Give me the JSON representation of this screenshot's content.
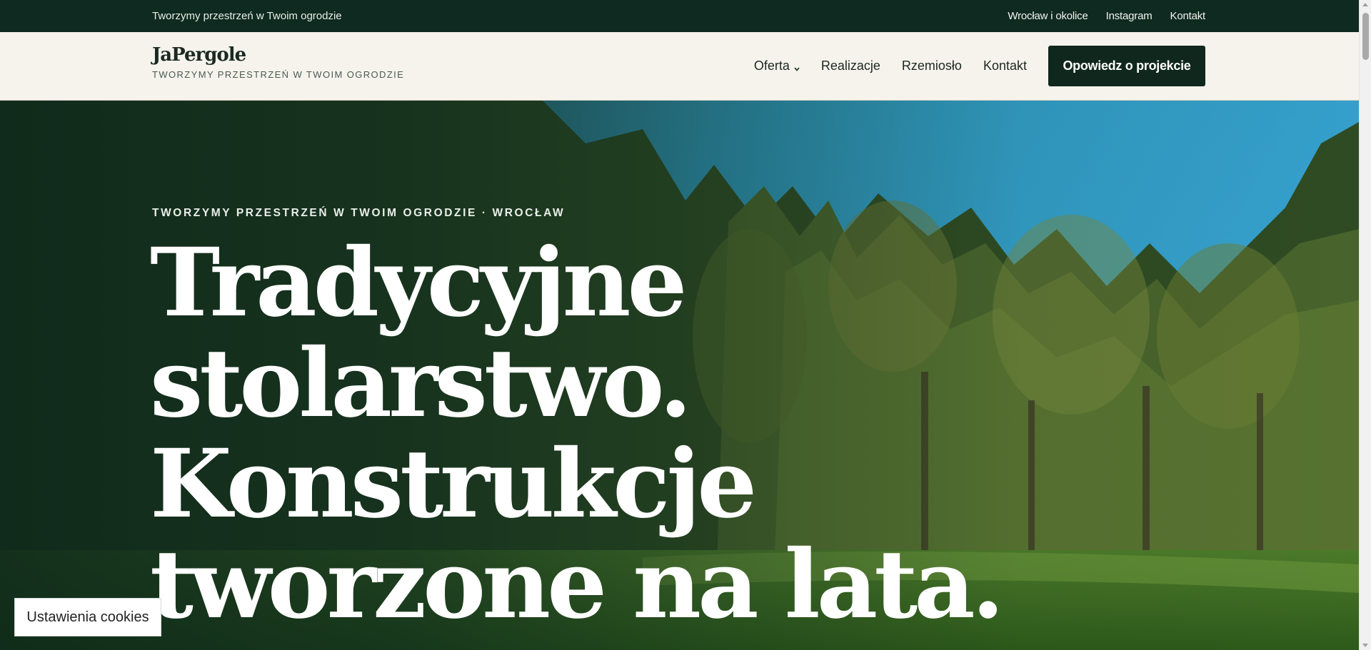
{
  "topbar": {
    "tagline": "Tworzymy przestrzeń w Twoim ogrodzie",
    "links": [
      "Wrocław i okolice",
      "Instagram",
      "Kontakt"
    ]
  },
  "header": {
    "logo_text": "JaPergole",
    "logo_tagline": "TWORZYMY PRZESTRZEŃ W TWOIM OGRODZIE",
    "nav": {
      "oferta": "Oferta",
      "realizacje": "Realizacje",
      "rzemioslo": "Rzemiosło",
      "kontakt": "Kontakt"
    },
    "cta_label": "Opowiedz o projekcie"
  },
  "hero": {
    "eyebrow": "TWORZYMY PRZESTRZEŃ W TWOIM OGRODZIE · WROCŁAW",
    "headline_lines": [
      "Tradycyjne",
      "stolarstwo.",
      "Konstrukcje",
      "tworzone na lata."
    ]
  },
  "cookie_button": "Ustawienia cookies",
  "colors": {
    "dark_green": "#10271d",
    "header_bg": "#f5f3ec",
    "cta_bg": "#10271d",
    "text_light": "#ffffff"
  },
  "icons": {
    "dropdown": "chevron-down-icon"
  }
}
